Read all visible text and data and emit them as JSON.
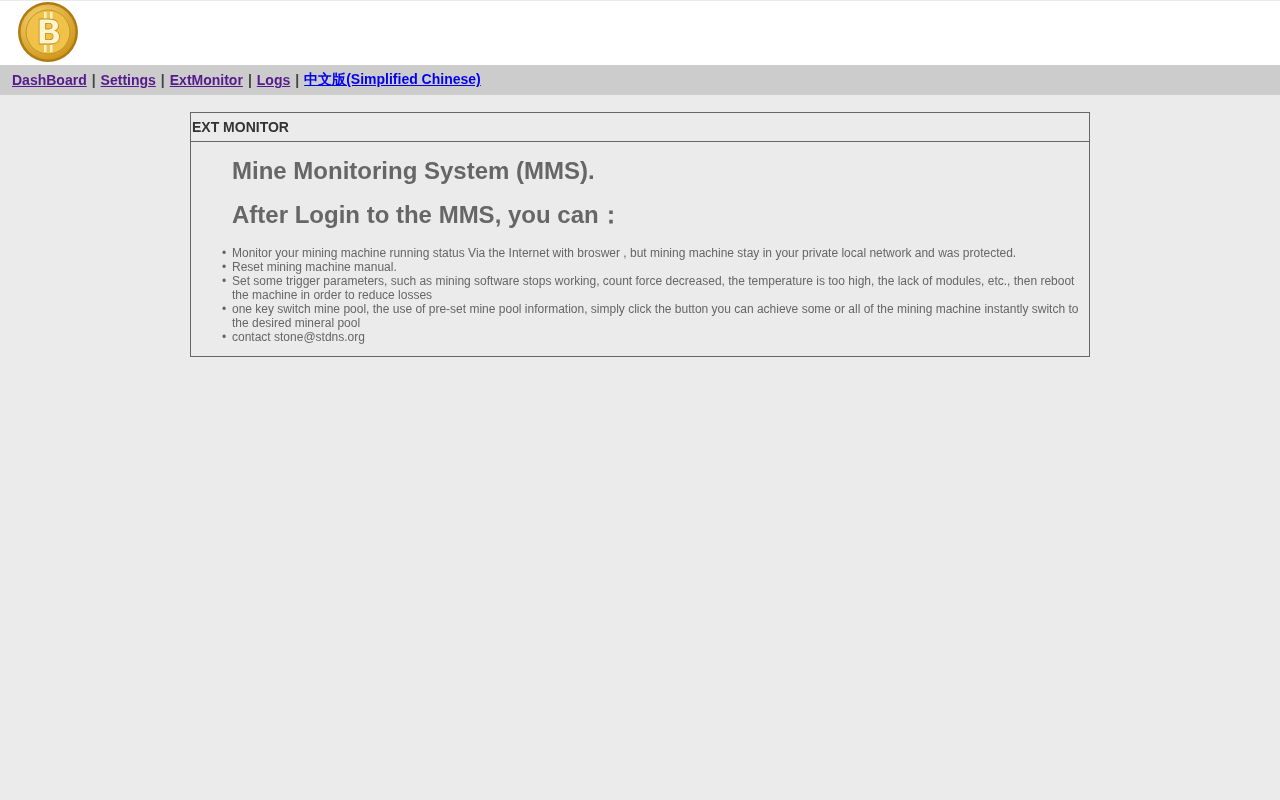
{
  "logo": {
    "symbol": "B"
  },
  "nav": [
    {
      "label": "DashBoard",
      "visited": true,
      "separator": "|"
    },
    {
      "label": "Settings",
      "visited": true,
      "separator": "|"
    },
    {
      "label": "ExtMonitor",
      "visited": true,
      "separator": "|"
    },
    {
      "label": "Logs",
      "visited": true,
      "separator": "|"
    },
    {
      "label": "中文版(Simplified Chinese)",
      "visited": false
    }
  ],
  "panel": {
    "title": "EXT MONITOR",
    "headings": [
      "Mine Monitoring System (MMS).",
      "After Login to the MMS, you can："
    ],
    "bullet": "•",
    "items": [
      "Monitor your mining machine running status Via the Internet with broswer , but mining machine stay in your private local network and was protected.",
      "Reset mining machine manual.",
      "Set some trigger parameters, such as mining software stops working, count force decreased, the temperature is too high, the lack of modules, etc., then reboot the machine in order to reduce losses",
      "one key switch mine pool, the use of pre-set mine pool information, simply click the button you can achieve some or all of the mining machine instantly switch to the desired mineral pool",
      "contact stone@stdns.org"
    ]
  }
}
